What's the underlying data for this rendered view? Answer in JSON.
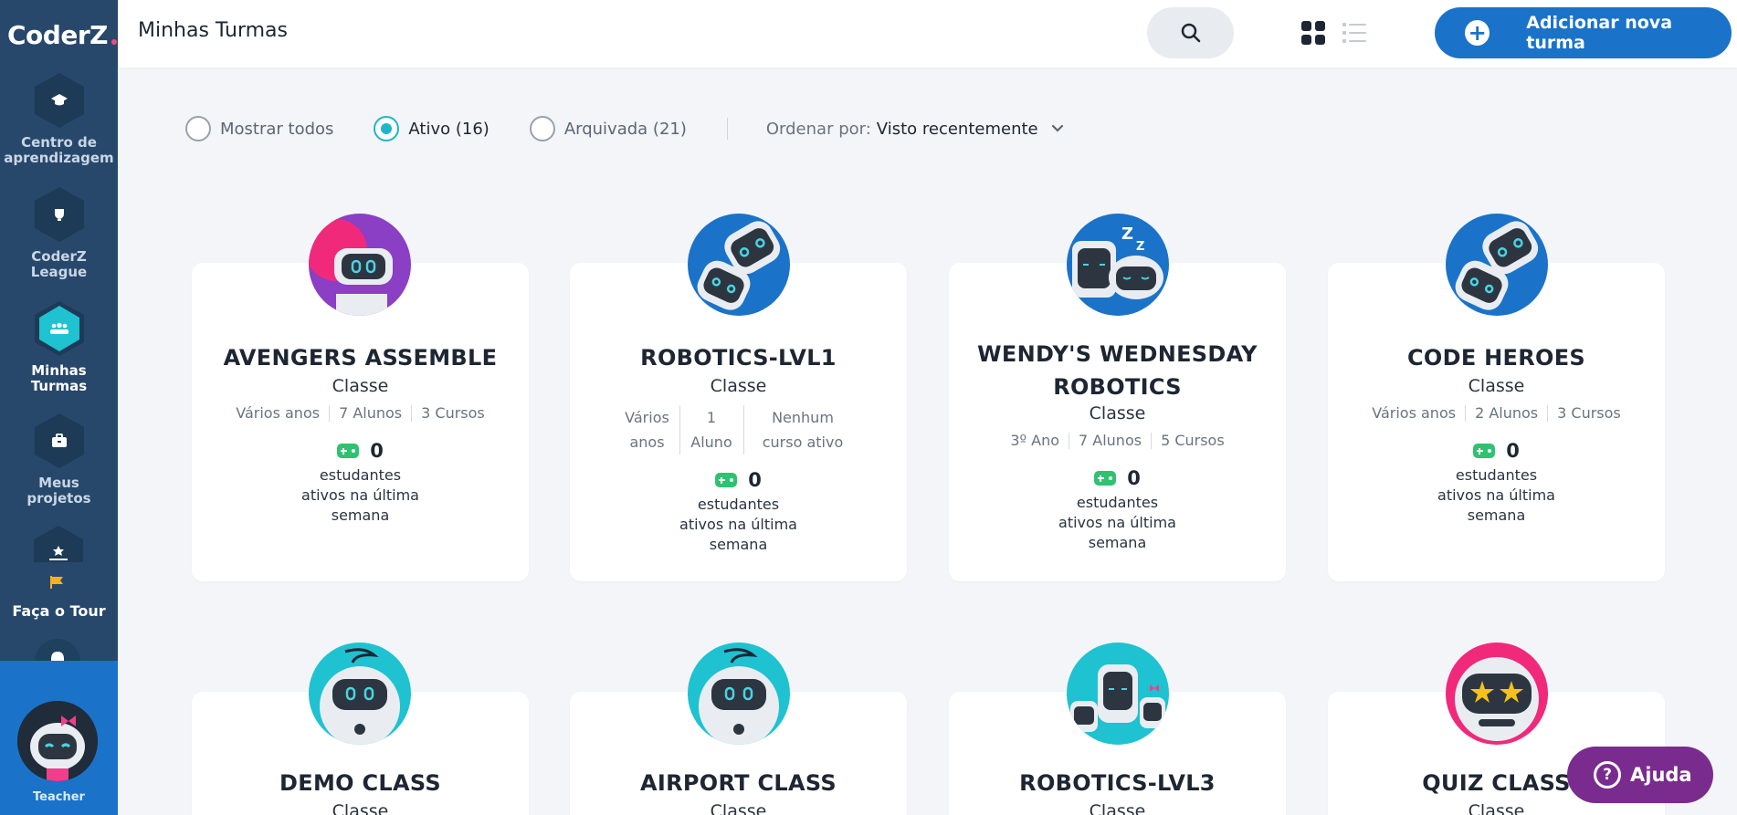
{
  "brand": {
    "logo": "CoderZ"
  },
  "sidebar": {
    "items": [
      {
        "label_line1": "Centro de",
        "label_line2": "aprendizagem"
      },
      {
        "label_line1": "CoderZ",
        "label_line2": "League"
      },
      {
        "label_line1": "Minhas",
        "label_line2": "Turmas"
      },
      {
        "label_line1": "Meus",
        "label_line2": "projetos"
      }
    ],
    "tour": "Faça o Tour",
    "user_role": "Teacher"
  },
  "header": {
    "title": "Minhas Turmas",
    "add_button": "Adicionar nova turma"
  },
  "filters": {
    "show_all": "Mostrar todos",
    "active": "Ativo (16)",
    "archived": "Arquivada (21)",
    "sort_label": "Ordenar por:",
    "sort_value": "Visto recentemente",
    "selected": "active"
  },
  "classes": [
    {
      "name": "AVENGERS ASSEMBLE",
      "type": "Classe",
      "meta": [
        "Vários anos",
        "7 Alunos",
        "3 Cursos"
      ],
      "active_count": "0",
      "active_text": [
        "estudantes",
        "ativos na última",
        "semana"
      ]
    },
    {
      "name": "ROBOTICS-LVL1",
      "type": "Classe",
      "meta": [
        "Vários anos",
        "1 Aluno",
        "Nenhum curso ativo"
      ],
      "active_count": "0",
      "active_text": [
        "estudantes",
        "ativos na última",
        "semana"
      ]
    },
    {
      "name_line1": "WENDY'S WEDNESDAY",
      "name_line2": "ROBOTICS",
      "type": "Classe",
      "meta": [
        "3º Ano",
        "7 Alunos",
        "5 Cursos"
      ],
      "active_count": "0",
      "active_text": [
        "estudantes",
        "ativos na última",
        "semana"
      ]
    },
    {
      "name": "CODE HEROES",
      "type": "Classe",
      "meta": [
        "Vários anos",
        "2 Alunos",
        "3 Cursos"
      ],
      "active_count": "0",
      "active_text": [
        "estudantes",
        "ativos na última",
        "semana"
      ]
    },
    {
      "name": "DEMO CLASS",
      "type": "Classe"
    },
    {
      "name": "AIRPORT CLASS",
      "type": "Classe"
    },
    {
      "name": "ROBOTICS-LVL3",
      "type": "Classe"
    },
    {
      "name": "QUIZ CLASS",
      "type": "Classe"
    }
  ],
  "help": {
    "label": "Ajuda"
  },
  "colors": {
    "sidebar": "#27486b",
    "primary": "#1a73c9",
    "accent": "#1fb6c8",
    "help": "#7a2b8e"
  }
}
